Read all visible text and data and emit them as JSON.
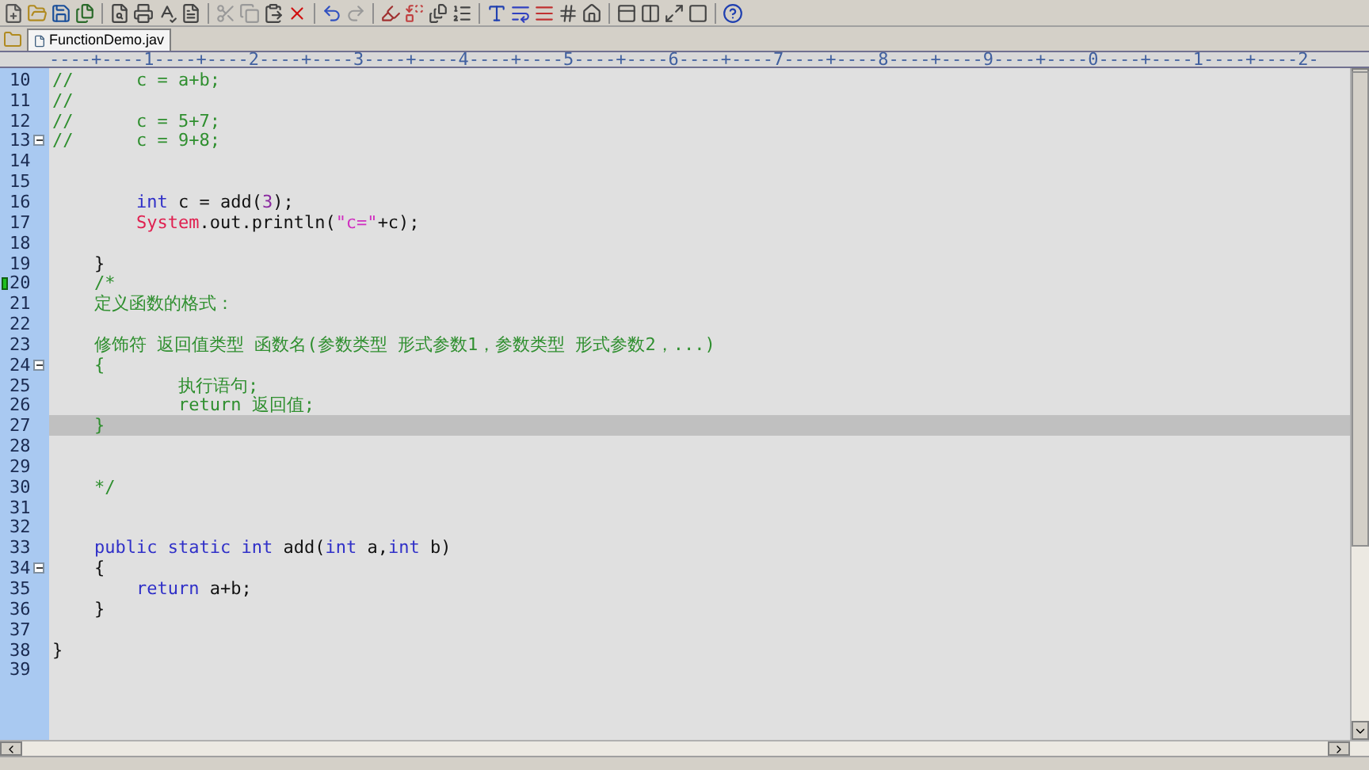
{
  "tabs": [
    {
      "label": "FunctionDemo.jav",
      "selected": true
    }
  ],
  "ruler": "----+----1----+----2----+----3----+----4----+----5----+----6----+----7----+----8----+----9----+----0----+----1----+----2-",
  "lines": [
    {
      "number": "10",
      "fold": false,
      "bookmark": false,
      "selected": false,
      "tokens": [
        {
          "text": "//      c = a+b;",
          "kind": "comment"
        }
      ]
    },
    {
      "number": "11",
      "fold": false,
      "bookmark": false,
      "selected": false,
      "tokens": [
        {
          "text": "//",
          "kind": "comment"
        }
      ]
    },
    {
      "number": "12",
      "fold": false,
      "bookmark": false,
      "selected": false,
      "tokens": [
        {
          "text": "//      c = 5+7;",
          "kind": "comment"
        }
      ]
    },
    {
      "number": "13",
      "fold": true,
      "bookmark": false,
      "selected": false,
      "tokens": [
        {
          "text": "//      c = 9+8;",
          "kind": "comment"
        }
      ]
    },
    {
      "number": "14",
      "fold": false,
      "bookmark": false,
      "selected": false
    },
    {
      "number": "15",
      "fold": false,
      "bookmark": false,
      "selected": false
    },
    {
      "number": "16",
      "fold": false,
      "bookmark": false,
      "selected": false,
      "tokens": [
        {
          "text": "        int",
          "kind": "keyword"
        },
        {
          "text": " c = add(",
          "kind": "plain"
        },
        {
          "text": "3",
          "kind": "number"
        },
        {
          "text": ");",
          "kind": "plain"
        }
      ]
    },
    {
      "number": "17",
      "fold": false,
      "bookmark": false,
      "selected": false,
      "tokens": [
        {
          "text": "        System",
          "kind": "class"
        },
        {
          "text": ".out.println(",
          "kind": "plain"
        },
        {
          "text": "\"c=\"",
          "kind": "string"
        },
        {
          "text": "+c);",
          "kind": "plain"
        }
      ]
    },
    {
      "number": "18",
      "fold": false,
      "bookmark": false,
      "selected": false
    },
    {
      "number": "19",
      "fold": false,
      "bookmark": false,
      "selected": false,
      "tokens": [
        {
          "text": "    }",
          "kind": "plain"
        }
      ]
    },
    {
      "number": "20",
      "fold": false,
      "bookmark": true,
      "selected": false,
      "tokens": [
        {
          "text": "    /*",
          "kind": "comment"
        }
      ]
    },
    {
      "number": "21",
      "fold": false,
      "bookmark": false,
      "selected": false,
      "tokens": [
        {
          "text": "    定义函数的格式：",
          "kind": "comment"
        }
      ]
    },
    {
      "number": "22",
      "fold": false,
      "bookmark": false,
      "selected": false
    },
    {
      "number": "23",
      "fold": false,
      "bookmark": false,
      "selected": false,
      "tokens": [
        {
          "text": "    修饰符 返回值类型 函数名(参数类型 形式参数1，参数类型 形式参数2，...)",
          "kind": "comment"
        }
      ]
    },
    {
      "number": "24",
      "fold": true,
      "bookmark": false,
      "selected": false,
      "tokens": [
        {
          "text": "    {",
          "kind": "comment"
        }
      ]
    },
    {
      "number": "25",
      "fold": false,
      "bookmark": false,
      "selected": false,
      "tokens": [
        {
          "text": "            执行语句;",
          "kind": "comment"
        }
      ]
    },
    {
      "number": "26",
      "fold": false,
      "bookmark": false,
      "selected": false,
      "tokens": [
        {
          "text": "            return 返回值;",
          "kind": "comment"
        }
      ]
    },
    {
      "number": "27",
      "fold": false,
      "bookmark": false,
      "selected": true,
      "tokens": [
        {
          "text": "    }",
          "kind": "comment"
        }
      ]
    },
    {
      "number": "28",
      "fold": false,
      "bookmark": false,
      "selected": false
    },
    {
      "number": "29",
      "fold": false,
      "bookmark": false,
      "selected": false
    },
    {
      "number": "30",
      "fold": false,
      "bookmark": false,
      "selected": false,
      "tokens": [
        {
          "text": "    */",
          "kind": "comment"
        }
      ]
    },
    {
      "number": "31",
      "fold": false,
      "bookmark": false,
      "selected": false
    },
    {
      "number": "32",
      "fold": false,
      "bookmark": false,
      "selected": false
    },
    {
      "number": "33",
      "fold": false,
      "bookmark": false,
      "selected": false,
      "tokens": [
        {
          "text": "    public static int",
          "kind": "keyword"
        },
        {
          "text": " add(",
          "kind": "plain"
        },
        {
          "text": "int",
          "kind": "keyword"
        },
        {
          "text": " a,",
          "kind": "plain"
        },
        {
          "text": "int",
          "kind": "keyword"
        },
        {
          "text": " b)",
          "kind": "plain"
        }
      ]
    },
    {
      "number": "34",
      "fold": true,
      "bookmark": false,
      "selected": false,
      "tokens": [
        {
          "text": "    {",
          "kind": "plain"
        }
      ]
    },
    {
      "number": "35",
      "fold": false,
      "bookmark": false,
      "selected": false,
      "tokens": [
        {
          "text": "        return",
          "kind": "keyword"
        },
        {
          "text": " a+b;",
          "kind": "plain"
        }
      ]
    },
    {
      "number": "36",
      "fold": false,
      "bookmark": false,
      "selected": false,
      "tokens": [
        {
          "text": "    }",
          "kind": "plain"
        }
      ]
    },
    {
      "number": "37",
      "fold": false,
      "bookmark": false,
      "selected": false
    },
    {
      "number": "38",
      "fold": false,
      "bookmark": false,
      "selected": false,
      "tokens": [
        {
          "text": "}",
          "kind": "plain"
        }
      ]
    },
    {
      "number": "39",
      "fold": false,
      "bookmark": false,
      "selected": false
    }
  ]
}
